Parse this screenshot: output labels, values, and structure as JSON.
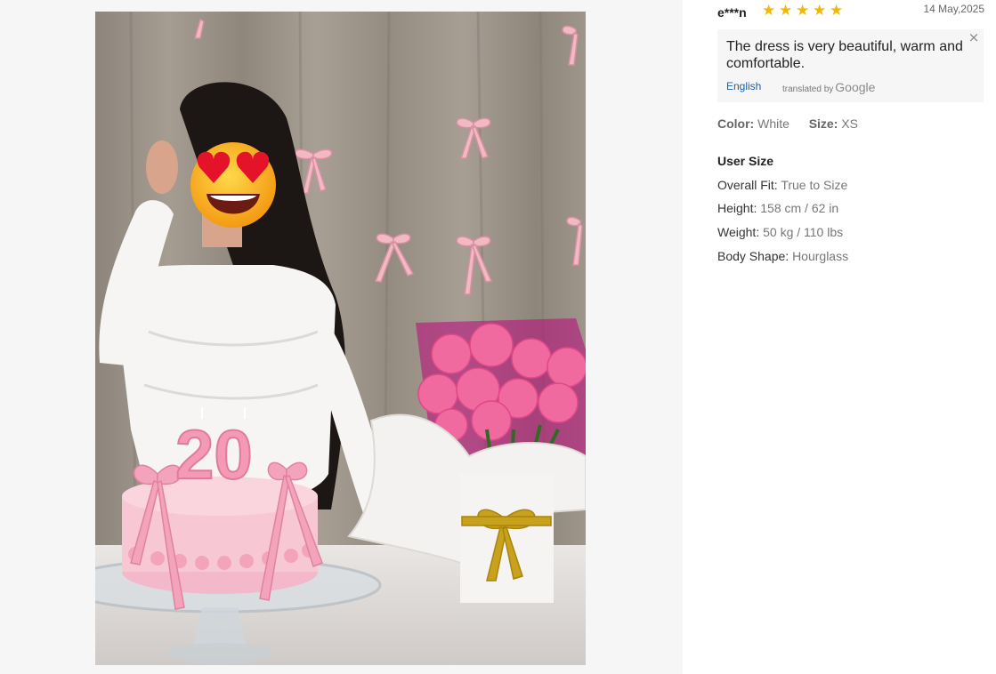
{
  "photo": {
    "cake_number": "20"
  },
  "review": {
    "reviewer": "e***n",
    "rating": 5,
    "star_glyph": "★",
    "date": "14 May,2025",
    "translated_text": "The dress is very beautiful, warm and comfortable.",
    "close_glyph": "×",
    "language_link": "English",
    "translated_by": "translated by",
    "google": "Google",
    "color_label": "Color:",
    "color_value": "White",
    "size_label": "Size:",
    "size_value": "XS",
    "user_size_title": "User Size",
    "user_size": [
      {
        "label": "Overall Fit:",
        "value": "True to Size"
      },
      {
        "label": "Height:",
        "value": "158 cm / 62 in"
      },
      {
        "label": "Weight:",
        "value": "50 kg / 110 lbs"
      },
      {
        "label": "Body Shape:",
        "value": "Hourglass"
      }
    ],
    "star_color": "#f5b800",
    "link_color": "#1d5fa8"
  }
}
